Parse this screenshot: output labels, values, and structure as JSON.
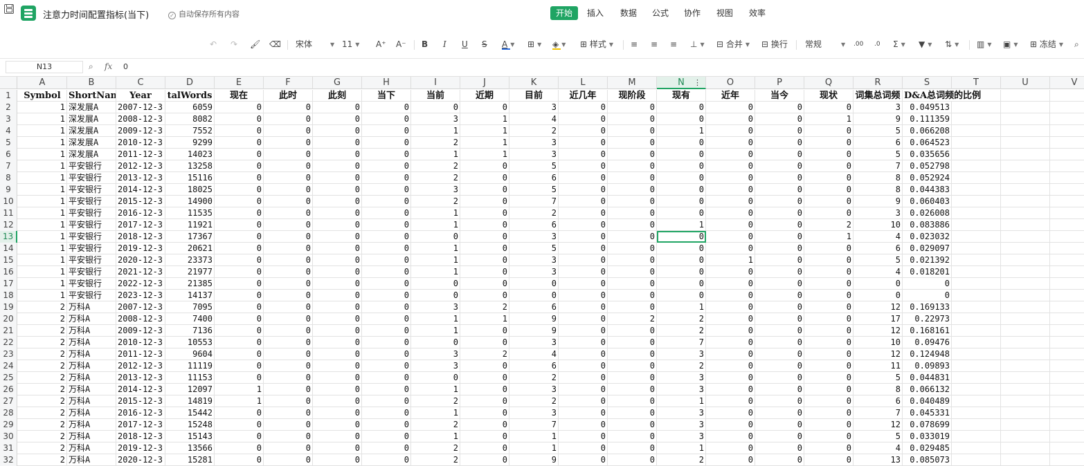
{
  "titlebar": {
    "doc_title": "注意力时间配置指标(当下)",
    "autosave": "自动保存所有内容",
    "tabs": [
      "开始",
      "插入",
      "数据",
      "公式",
      "协作",
      "视图",
      "效率"
    ],
    "active_tab": "开始",
    "accent_color": "#1fa463"
  },
  "toolbar": {
    "font_name": "宋体",
    "font_size": "11",
    "bold": "B",
    "italic": "I",
    "underline": "U",
    "strike": "S",
    "font_color": "A",
    "style_label": "样式",
    "merge_label": "合并",
    "wrap_label": "换行",
    "format_label": "常规",
    "freeze_label": "冻结"
  },
  "formula_bar": {
    "cell_ref": "N13",
    "fx": "fx",
    "value": "0"
  },
  "sheet": {
    "columns": [
      "A",
      "B",
      "C",
      "D",
      "E",
      "F",
      "G",
      "H",
      "I",
      "J",
      "K",
      "L",
      "M",
      "N",
      "O",
      "P",
      "Q",
      "R",
      "S",
      "T",
      "U",
      "V"
    ],
    "selected_column": "N",
    "selected_row": 13,
    "header_row": [
      "Symbol",
      "ShortName",
      "Year",
      "TotalWords",
      "现在",
      "此时",
      "此刻",
      "当下",
      "当前",
      "近期",
      "目前",
      "近几年",
      "现阶段",
      "现有",
      "近年",
      "当今",
      "现状",
      "词集总词频",
      "D&A总词频的比例"
    ],
    "header_display": [
      "Symbol",
      "ShortNam",
      "Year",
      "talWords",
      "现在",
      "此时",
      "此刻",
      "当下",
      "当前",
      "近期",
      "目前",
      "近几年",
      "现阶段",
      "现有",
      "近年",
      "当今",
      "现状",
      "词集总词频",
      "D&A总词频的比例"
    ],
    "data_rows": [
      [
        "1",
        "深发展A",
        "2007-12-3",
        "6059",
        "0",
        "0",
        "0",
        "0",
        "0",
        "0",
        "3",
        "0",
        "0",
        "0",
        "0",
        "0",
        "0",
        "3",
        "0.049513"
      ],
      [
        "1",
        "深发展A",
        "2008-12-3",
        "8082",
        "0",
        "0",
        "0",
        "0",
        "3",
        "1",
        "4",
        "0",
        "0",
        "0",
        "0",
        "0",
        "1",
        "9",
        "0.111359"
      ],
      [
        "1",
        "深发展A",
        "2009-12-3",
        "7552",
        "0",
        "0",
        "0",
        "0",
        "1",
        "1",
        "2",
        "0",
        "0",
        "1",
        "0",
        "0",
        "0",
        "5",
        "0.066208"
      ],
      [
        "1",
        "深发展A",
        "2010-12-3",
        "9299",
        "0",
        "0",
        "0",
        "0",
        "2",
        "1",
        "3",
        "0",
        "0",
        "0",
        "0",
        "0",
        "0",
        "6",
        "0.064523"
      ],
      [
        "1",
        "深发展A",
        "2011-12-3",
        "14023",
        "0",
        "0",
        "0",
        "0",
        "1",
        "1",
        "3",
        "0",
        "0",
        "0",
        "0",
        "0",
        "0",
        "5",
        "0.035656"
      ],
      [
        "1",
        "平安银行",
        "2012-12-3",
        "13258",
        "0",
        "0",
        "0",
        "0",
        "2",
        "0",
        "5",
        "0",
        "0",
        "0",
        "0",
        "0",
        "0",
        "7",
        "0.052798"
      ],
      [
        "1",
        "平安银行",
        "2013-12-3",
        "15116",
        "0",
        "0",
        "0",
        "0",
        "2",
        "0",
        "6",
        "0",
        "0",
        "0",
        "0",
        "0",
        "0",
        "8",
        "0.052924"
      ],
      [
        "1",
        "平安银行",
        "2014-12-3",
        "18025",
        "0",
        "0",
        "0",
        "0",
        "3",
        "0",
        "5",
        "0",
        "0",
        "0",
        "0",
        "0",
        "0",
        "8",
        "0.044383"
      ],
      [
        "1",
        "平安银行",
        "2015-12-3",
        "14900",
        "0",
        "0",
        "0",
        "0",
        "2",
        "0",
        "7",
        "0",
        "0",
        "0",
        "0",
        "0",
        "0",
        "9",
        "0.060403"
      ],
      [
        "1",
        "平安银行",
        "2016-12-3",
        "11535",
        "0",
        "0",
        "0",
        "0",
        "1",
        "0",
        "2",
        "0",
        "0",
        "0",
        "0",
        "0",
        "0",
        "3",
        "0.026008"
      ],
      [
        "1",
        "平安银行",
        "2017-12-3",
        "11921",
        "0",
        "0",
        "0",
        "0",
        "1",
        "0",
        "6",
        "0",
        "0",
        "1",
        "0",
        "0",
        "2",
        "10",
        "0.083886"
      ],
      [
        "1",
        "平安银行",
        "2018-12-3",
        "17367",
        "0",
        "0",
        "0",
        "0",
        "0",
        "0",
        "3",
        "0",
        "0",
        "0",
        "0",
        "0",
        "1",
        "4",
        "0.023032"
      ],
      [
        "1",
        "平安银行",
        "2019-12-3",
        "20621",
        "0",
        "0",
        "0",
        "0",
        "1",
        "0",
        "5",
        "0",
        "0",
        "0",
        "0",
        "0",
        "0",
        "6",
        "0.029097"
      ],
      [
        "1",
        "平安银行",
        "2020-12-3",
        "23373",
        "0",
        "0",
        "0",
        "0",
        "1",
        "0",
        "3",
        "0",
        "0",
        "0",
        "1",
        "0",
        "0",
        "5",
        "0.021392"
      ],
      [
        "1",
        "平安银行",
        "2021-12-3",
        "21977",
        "0",
        "0",
        "0",
        "0",
        "1",
        "0",
        "3",
        "0",
        "0",
        "0",
        "0",
        "0",
        "0",
        "4",
        "0.018201"
      ],
      [
        "1",
        "平安银行",
        "2022-12-3",
        "21385",
        "0",
        "0",
        "0",
        "0",
        "0",
        "0",
        "0",
        "0",
        "0",
        "0",
        "0",
        "0",
        "0",
        "0",
        "0"
      ],
      [
        "1",
        "平安银行",
        "2023-12-3",
        "14137",
        "0",
        "0",
        "0",
        "0",
        "0",
        "0",
        "0",
        "0",
        "0",
        "0",
        "0",
        "0",
        "0",
        "0",
        "0"
      ],
      [
        "2",
        "万科A",
        "2007-12-3",
        "7095",
        "0",
        "0",
        "0",
        "0",
        "3",
        "2",
        "6",
        "0",
        "0",
        "1",
        "0",
        "0",
        "0",
        "12",
        "0.169133"
      ],
      [
        "2",
        "万科A",
        "2008-12-3",
        "7400",
        "0",
        "0",
        "0",
        "0",
        "1",
        "1",
        "9",
        "0",
        "2",
        "2",
        "0",
        "0",
        "0",
        "17",
        "0.22973"
      ],
      [
        "2",
        "万科A",
        "2009-12-3",
        "7136",
        "0",
        "0",
        "0",
        "0",
        "1",
        "0",
        "9",
        "0",
        "0",
        "2",
        "0",
        "0",
        "0",
        "12",
        "0.168161"
      ],
      [
        "2",
        "万科A",
        "2010-12-3",
        "10553",
        "0",
        "0",
        "0",
        "0",
        "0",
        "0",
        "3",
        "0",
        "0",
        "7",
        "0",
        "0",
        "0",
        "10",
        "0.09476"
      ],
      [
        "2",
        "万科A",
        "2011-12-3",
        "9604",
        "0",
        "0",
        "0",
        "0",
        "3",
        "2",
        "4",
        "0",
        "0",
        "3",
        "0",
        "0",
        "0",
        "12",
        "0.124948"
      ],
      [
        "2",
        "万科A",
        "2012-12-3",
        "11119",
        "0",
        "0",
        "0",
        "0",
        "3",
        "0",
        "6",
        "0",
        "0",
        "2",
        "0",
        "0",
        "0",
        "11",
        "0.09893"
      ],
      [
        "2",
        "万科A",
        "2013-12-3",
        "11153",
        "0",
        "0",
        "0",
        "0",
        "0",
        "0",
        "2",
        "0",
        "0",
        "3",
        "0",
        "0",
        "0",
        "5",
        "0.044831"
      ],
      [
        "2",
        "万科A",
        "2014-12-3",
        "12097",
        "1",
        "0",
        "0",
        "0",
        "1",
        "0",
        "3",
        "0",
        "0",
        "3",
        "0",
        "0",
        "0",
        "8",
        "0.066132"
      ],
      [
        "2",
        "万科A",
        "2015-12-3",
        "14819",
        "1",
        "0",
        "0",
        "0",
        "2",
        "0",
        "2",
        "0",
        "0",
        "1",
        "0",
        "0",
        "0",
        "6",
        "0.040489"
      ],
      [
        "2",
        "万科A",
        "2016-12-3",
        "15442",
        "0",
        "0",
        "0",
        "0",
        "1",
        "0",
        "3",
        "0",
        "0",
        "3",
        "0",
        "0",
        "0",
        "7",
        "0.045331"
      ],
      [
        "2",
        "万科A",
        "2017-12-3",
        "15248",
        "0",
        "0",
        "0",
        "0",
        "2",
        "0",
        "7",
        "0",
        "0",
        "3",
        "0",
        "0",
        "0",
        "12",
        "0.078699"
      ],
      [
        "2",
        "万科A",
        "2018-12-3",
        "15143",
        "0",
        "0",
        "0",
        "0",
        "1",
        "0",
        "1",
        "0",
        "0",
        "3",
        "0",
        "0",
        "0",
        "5",
        "0.033019"
      ],
      [
        "2",
        "万科A",
        "2019-12-3",
        "13566",
        "0",
        "0",
        "0",
        "0",
        "2",
        "0",
        "1",
        "0",
        "0",
        "1",
        "0",
        "0",
        "0",
        "4",
        "0.029485"
      ],
      [
        "2",
        "万科A",
        "2020-12-3",
        "15281",
        "0",
        "0",
        "0",
        "0",
        "2",
        "0",
        "9",
        "0",
        "0",
        "2",
        "0",
        "0",
        "0",
        "13",
        "0.085073"
      ]
    ]
  }
}
